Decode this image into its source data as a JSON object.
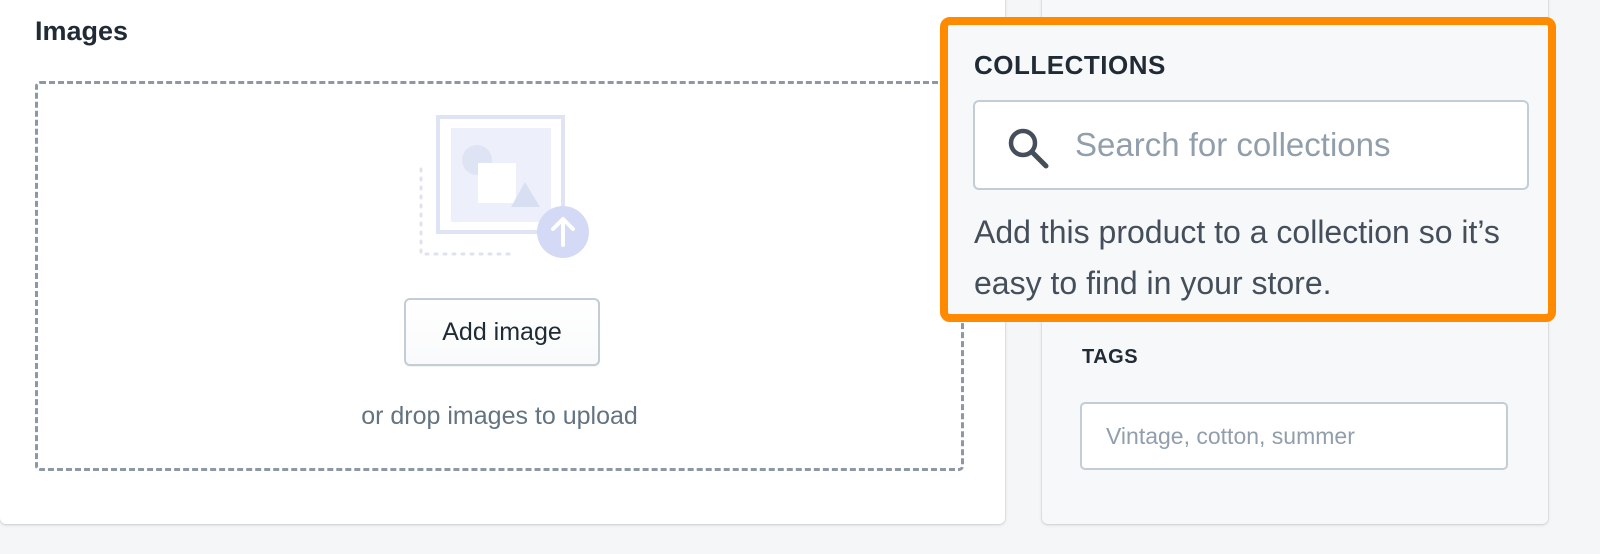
{
  "images": {
    "title": "Images",
    "add_button_label": "Add image",
    "drop_hint": "or drop images to upload"
  },
  "collections": {
    "title": "COLLECTIONS",
    "search_placeholder": "Search for collections",
    "search_value": "",
    "help_text": "Add this product to a collection so it’s easy to find in your store.",
    "highlight_color": "#ff8a00"
  },
  "tags": {
    "label": "TAGS",
    "placeholder": "Vintage, cotton, summer",
    "value": ""
  },
  "icons": {
    "search": "search-icon",
    "upload": "upload-arrow-icon",
    "image_placeholder": "image-placeholder-icon"
  }
}
